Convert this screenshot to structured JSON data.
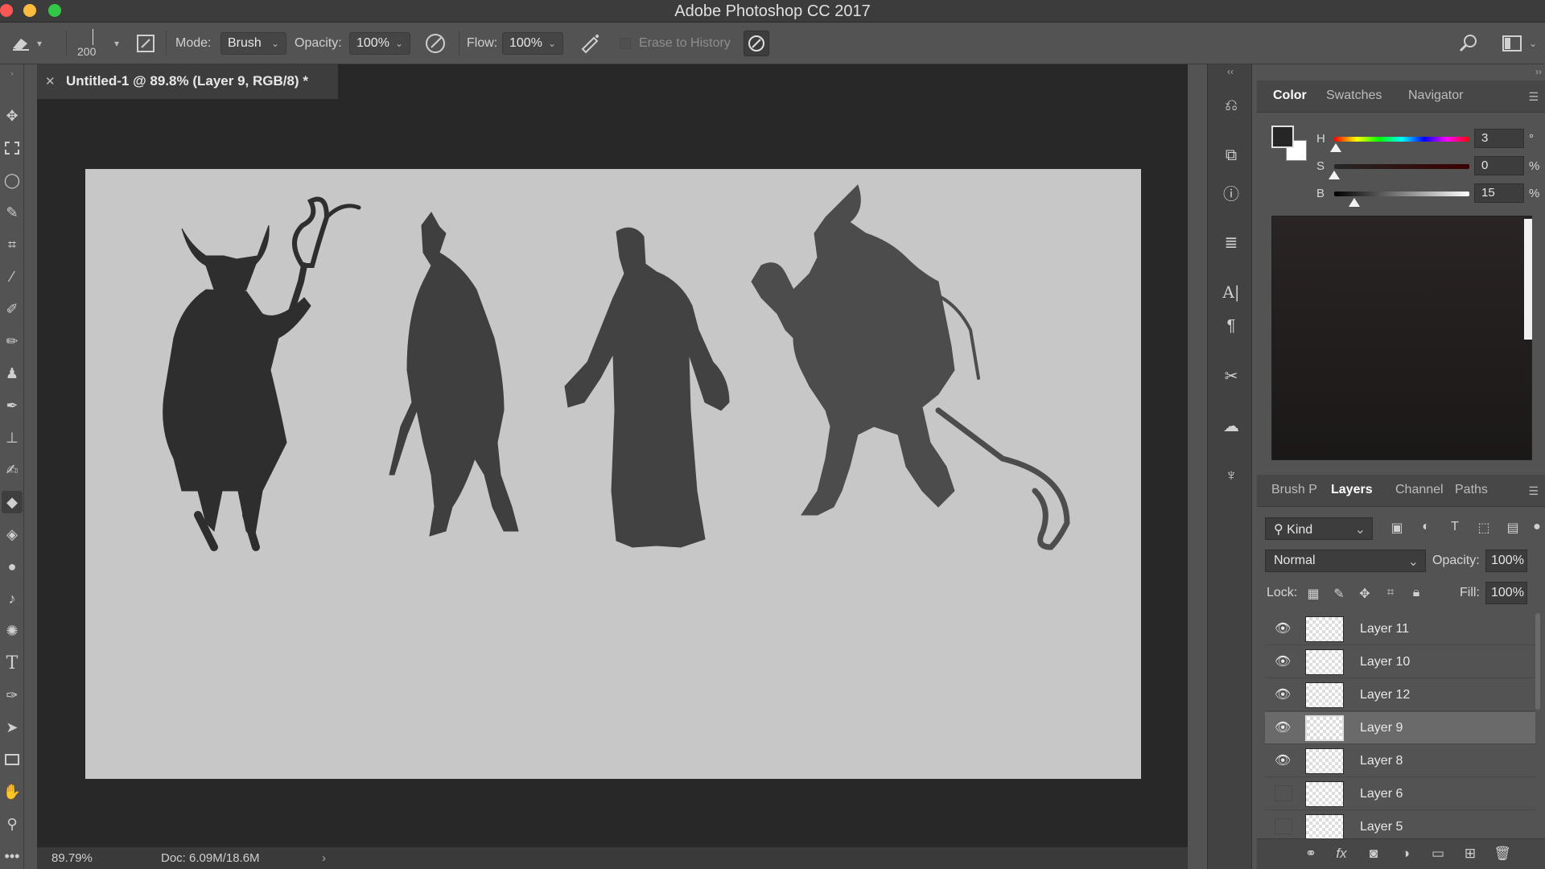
{
  "window": {
    "title": "Adobe Photoshop CC 2017"
  },
  "options_bar": {
    "brush_size": "200",
    "mode_label": "Mode:",
    "mode_value": "Brush",
    "opacity_label": "Opacity:",
    "opacity_value": "100%",
    "flow_label": "Flow:",
    "flow_value": "100%",
    "erase_to_history": "Erase to History"
  },
  "document": {
    "tab_title": "Untitled-1 @ 89.8% (Layer 9, RGB/8) *",
    "zoom": "89.79%",
    "doc_info": "Doc: 6.09M/18.6M"
  },
  "color_panel": {
    "tabs": [
      "Color",
      "Swatches",
      "Navigator"
    ],
    "active_tab": "Color",
    "sliders": [
      {
        "label": "H",
        "value": "3",
        "unit": "°",
        "fraction": 0.01
      },
      {
        "label": "S",
        "value": "0",
        "unit": "%",
        "fraction": 0.0
      },
      {
        "label": "B",
        "value": "15",
        "unit": "%",
        "fraction": 0.15
      }
    ],
    "foreground_color": "#262626",
    "background_color": "#ffffff"
  },
  "layers_panel": {
    "tabs": [
      "Brush P",
      "Layers",
      "Channel",
      "Paths"
    ],
    "active_tab": "Layers",
    "filter_kind": "Kind",
    "blend_mode": "Normal",
    "opacity_label": "Opacity:",
    "opacity_value": "100%",
    "lock_label": "Lock:",
    "fill_label": "Fill:",
    "fill_value": "100%",
    "layers": [
      {
        "name": "Layer 11",
        "visible": true,
        "selected": false
      },
      {
        "name": "Layer 10",
        "visible": true,
        "selected": false
      },
      {
        "name": "Layer 12",
        "visible": true,
        "selected": false
      },
      {
        "name": "Layer 9",
        "visible": true,
        "selected": true
      },
      {
        "name": "Layer 8",
        "visible": true,
        "selected": false
      },
      {
        "name": "Layer 6",
        "visible": false,
        "selected": false
      },
      {
        "name": "Layer 5",
        "visible": false,
        "selected": false
      }
    ]
  },
  "colors": {
    "canvas": "#c7c7c7",
    "workspace": "#282828",
    "panel": "#535353"
  }
}
